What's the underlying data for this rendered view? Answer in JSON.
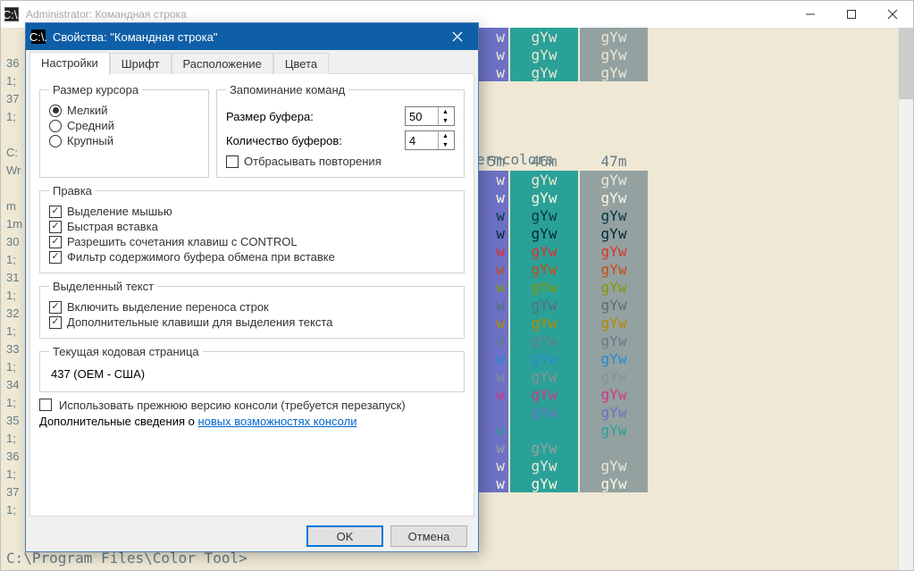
{
  "main_window": {
    "title": "Administrator: Командная строка",
    "icon_text": "C:\\."
  },
  "console": {
    "left_lines": [
      "36",
      "1;",
      "37",
      "1;",
      "",
      "C:",
      "Wr",
      "",
      "m ",
      "1m",
      "30",
      "1;",
      "31",
      "1;",
      "32",
      "1;",
      "33",
      "1;",
      "34",
      "1;",
      "35",
      "1;",
      "36",
      "1;",
      "37",
      "1;",
      ""
    ],
    "termcolors_label": "ermcolors",
    "col_headers": [
      "5m",
      "46m",
      "47m"
    ],
    "col45_bg1": "#6c71c4",
    "col45_bg2": "#6c71c4",
    "col46_bg": "#2aa198",
    "col47_bg": "#93a1a1",
    "sample_text": "gYw",
    "row_colors": [
      "#eee8d5",
      "#fdf6e3",
      "#073642",
      "#002b36",
      "#dc322f",
      "#cb4b16",
      "#859900",
      "#586e75",
      "#b58900",
      "#657b83",
      "#268bd2",
      "#839496",
      "#d33682",
      "#6c71c4",
      "#2aa198",
      "#93a1a1",
      "#eee8d5",
      "#fdf6e3"
    ],
    "prompt": "C:\\Program Files\\Color Tool>"
  },
  "dialog": {
    "title": "Свойства: \"Командная строка\"",
    "tabs": [
      "Настройки",
      "Шрифт",
      "Расположение",
      "Цвета"
    ],
    "cursor_group": {
      "legend": "Размер курсора",
      "options": [
        "Мелкий",
        "Средний",
        "Крупный"
      ],
      "selected": 0
    },
    "history_group": {
      "legend": "Запоминание команд",
      "buffer_size_label": "Размер буфера:",
      "buffer_size": "50",
      "buffer_count_label": "Количество буферов:",
      "buffer_count": "4",
      "discard_dup": "Отбрасывать повторения"
    },
    "edit_group": {
      "legend": "Правка",
      "opts": [
        "Выделение мышью",
        "Быстрая вставка",
        "Разрешить сочетания клавиш с CONTROL",
        "Фильтр содержимого буфера обмена при вставке"
      ]
    },
    "sel_group": {
      "legend": "Выделенный текст",
      "opts": [
        "Включить выделение переноса строк",
        "Дополнительные клавиши для выделения текста"
      ]
    },
    "codepage_group": {
      "legend": "Текущая кодовая страница",
      "value": "437  (OEM - США)"
    },
    "legacy": {
      "label": "Использовать прежнюю версию консоли (требуется перезапуск)",
      "more_prefix": "Дополнительные сведения о ",
      "more_link": "новых возможностях консоли"
    },
    "buttons": {
      "ok": "OK",
      "cancel": "Отмена"
    }
  }
}
